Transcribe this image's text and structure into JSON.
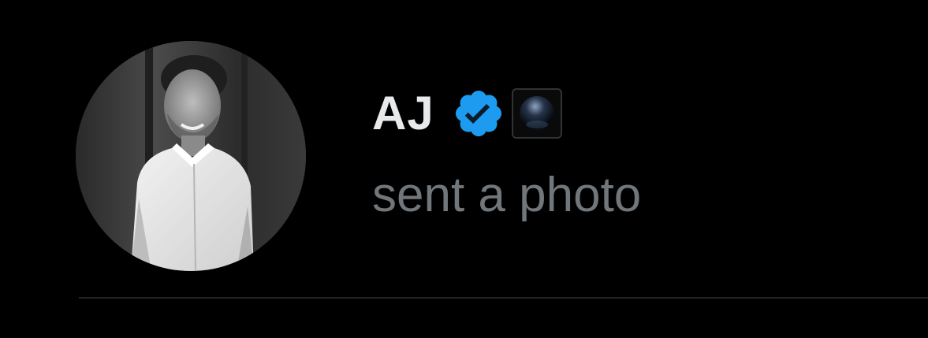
{
  "message_row": {
    "sender_name": "AJ",
    "preview_text": "sent a photo",
    "verified_badge_color": "#1d9bf0",
    "avatar_icon": "person-photo-avatar",
    "badge_icon": "verified-badge-icon",
    "affiliate_icon": "affiliate-badge-icon"
  },
  "colors": {
    "background": "#000000",
    "name_text": "#e7e9ea",
    "secondary_text": "#71767b",
    "divider": "#1f2326"
  }
}
